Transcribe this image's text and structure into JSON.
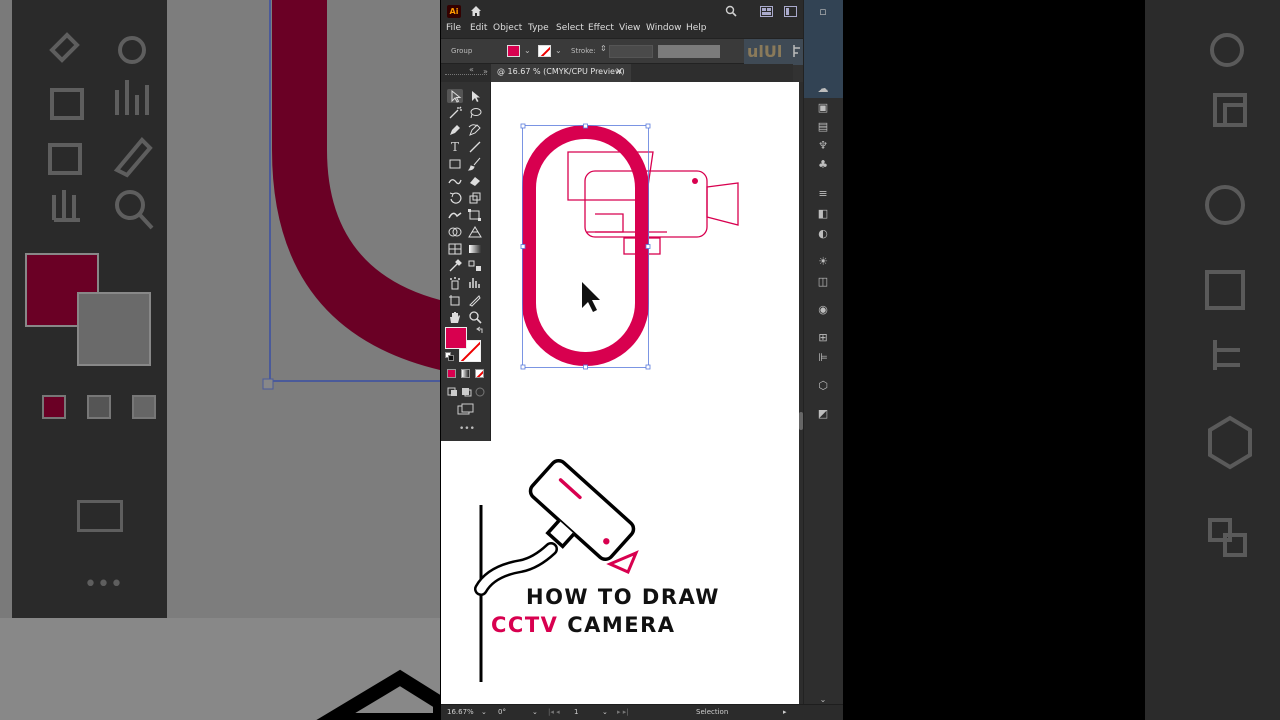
{
  "app": {
    "logo_text": "Ai",
    "menu": [
      "File",
      "Edit",
      "Object",
      "Type",
      "Select",
      "Effect",
      "View",
      "Window",
      "Help"
    ],
    "control_bar": {
      "selection_label": "Group",
      "stroke_label": "Stroke:"
    },
    "document_tab": {
      "label": "@ 16.67 % (CMYK/CPU Preview)",
      "close_glyph": "×"
    },
    "status_bar": {
      "zoom": "16.67%",
      "rotation": "0°",
      "artboard_number": "1",
      "tool": "Selection"
    },
    "colors": {
      "accent": "#d8004f",
      "ui_dark": "#323232",
      "artboard": "#ffffff"
    }
  },
  "artwork": {
    "title_line1": "HOW TO DRAW",
    "title_line2_highlight": "CCTV",
    "title_line2_rest": "CAMERA"
  },
  "icons": {
    "titlebar": [
      "home-icon",
      "search-icon",
      "arrange-documents-icon",
      "workspace-icon",
      "minimize-icon",
      "maximize-icon"
    ],
    "tools": [
      "selection-tool-icon",
      "direct-selection-tool-icon",
      "magic-wand-tool-icon",
      "lasso-tool-icon",
      "pen-tool-icon",
      "curvature-tool-icon",
      "type-tool-icon",
      "line-tool-icon",
      "rectangle-tool-icon",
      "paintbrush-tool-icon",
      "shaper-tool-icon",
      "eraser-tool-icon",
      "rotate-tool-icon",
      "scale-tool-icon",
      "warp-tool-icon",
      "free-transform-tool-icon",
      "shape-builder-tool-icon",
      "perspective-grid-tool-icon",
      "mesh-tool-icon",
      "gradient-tool-icon",
      "eyedropper-tool-icon",
      "blend-tool-icon",
      "symbol-sprayer-tool-icon",
      "column-graph-tool-icon",
      "artboard-tool-icon",
      "slice-tool-icon",
      "hand-tool-icon",
      "zoom-tool-icon"
    ]
  }
}
